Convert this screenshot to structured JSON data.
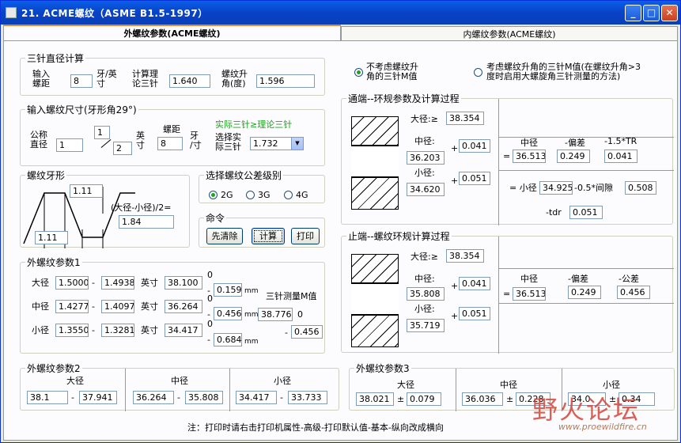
{
  "window": {
    "title": "21. ACME螺纹（ASME B1.5-1997）"
  },
  "tabs": [
    "外螺纹参数(ACME螺纹)",
    "内螺纹参数(ACME螺纹)"
  ],
  "three_wire": {
    "title": "三针直径计算",
    "pitch_label": "输入\n螺距",
    "pitch": "8",
    "pitch_unit": "牙/英\n寸",
    "theory_label": "计算理\n论三针",
    "theory": "1.640",
    "lead_label": "螺纹升\n角(度)",
    "lead": "1.596"
  },
  "size_input": {
    "title": "输入螺纹尺寸(牙形角29°)",
    "actual_note": "实际三针≥理论三针",
    "nominal_label": "公称\n直径",
    "whole": "1",
    "num": "1",
    "den": "2",
    "inch": "英\n寸",
    "pitch_label": "螺距",
    "pitch": "8",
    "pitch_unit": "牙\n/寸",
    "select_label": "选择实\n际三针",
    "select_value": "1.732"
  },
  "profile": {
    "title": "螺纹牙形",
    "top": "1.11",
    "bottom": "1.11",
    "formula": "(大径-小径)/2=",
    "formula_value": "1.84"
  },
  "tolerance": {
    "title": "选择螺纹公差级别",
    "options": [
      "2G",
      "3G",
      "4G"
    ]
  },
  "commands": {
    "title": "命令",
    "clear": "先清除",
    "calc": "计算",
    "print": "打印"
  },
  "options": {
    "opt1": "不考虑螺纹升\n角的三针M值",
    "opt2": "考虑螺纹升角的三针M值(在螺纹升角>3\n度时启用大螺旋角三针测量的方法)"
  },
  "go": {
    "title": "通端--环规参数及计算过程",
    "major_label": "大径:≥",
    "major": "38.354",
    "pitch_label": "中径:",
    "pitch": "36.203",
    "pitch_add": "0.041",
    "minor_label": "小径:",
    "minor": "34.620",
    "minor_add": "0.051",
    "eq": "=",
    "col_pitch": "中径",
    "col_dev": "-偏差",
    "col_tr": "-1.5*TR",
    "v_pitch": "36.513",
    "v_dev": "0.249",
    "v_tr": "0.041",
    "minor_eq": "= 小径",
    "minor_val": "34.925",
    "clear_lbl": "-0.5*间隙",
    "clear_val": "0.508",
    "tdr_lbl": "-tdr",
    "tdr_val": "0.051",
    "plus": "+"
  },
  "nogo": {
    "title": "止端--螺纹环规计算过程",
    "major_label": "大径:≥",
    "major": "38.354",
    "pitch_label": "中径:",
    "pitch": "35.808",
    "pitch_add": "0.041",
    "minor_label": "小径:",
    "minor": "35.719",
    "minor_add": "0.051",
    "eq": "=",
    "col_pitch": "中径",
    "col_dev": "-偏差",
    "col_tol": "-公差",
    "v_pitch": "36.513",
    "v_dev": "0.249",
    "v_tol": "0.456",
    "plus": "+"
  },
  "ext1": {
    "title": "外螺纹参数1",
    "rows": [
      {
        "name": "大径",
        "a": "1.5000",
        "b": "1.4938",
        "unit": "英寸",
        "mm": "38.100",
        "top": "0",
        "bot": "0.159",
        "mmu": "mm"
      },
      {
        "name": "中径",
        "a": "1.4277",
        "b": "1.4097",
        "unit": "英寸",
        "mm": "36.264",
        "top": "0",
        "bot": "0.456",
        "mmu": "mm"
      },
      {
        "name": "小径",
        "a": "1.3550",
        "b": "1.3281",
        "unit": "英寸",
        "mm": "34.417",
        "top": "0",
        "bot": "0.684",
        "mmu": "mm"
      }
    ],
    "m_label": "三针测量M值",
    "m": "38.776",
    "m_top": "0",
    "m_bot": "0.456",
    "dash": "-"
  },
  "ext2": {
    "title": "外螺纹参数2",
    "cols": [
      {
        "name": "大径",
        "a": "38.1",
        "b": "37.941"
      },
      {
        "name": "中径",
        "a": "36.264",
        "b": "35.808"
      },
      {
        "name": "小径",
        "a": "34.417",
        "b": "33.733"
      }
    ],
    "dash": "-"
  },
  "ext3": {
    "title": "外螺纹参数3",
    "cols": [
      {
        "name": "大径",
        "a": "38.021",
        "b": "0.079"
      },
      {
        "name": "中径",
        "a": "36.036",
        "b": "0.228"
      },
      {
        "name": "小径",
        "a": "34.0",
        "b": "0.34"
      }
    ],
    "pm": "±"
  },
  "footer": "注：打印时请右击打印机属性-高级-打印默认值-基本-纵向改成横向",
  "watermark": {
    "text": "野火论坛",
    "url": "www.proewildfire.cn"
  }
}
